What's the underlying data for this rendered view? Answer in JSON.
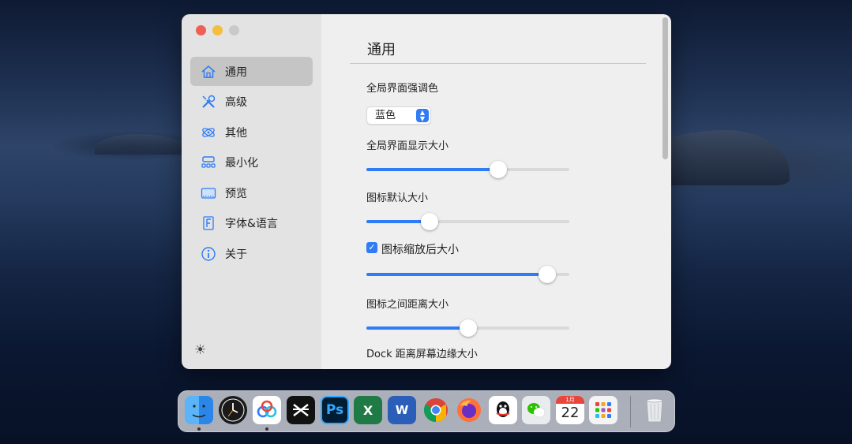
{
  "window": {
    "sidebar": {
      "items": [
        {
          "label": "通用",
          "icon": "home-icon",
          "active": true
        },
        {
          "label": "高级",
          "icon": "tools-icon",
          "active": false
        },
        {
          "label": "其他",
          "icon": "atom-icon",
          "active": false
        },
        {
          "label": "最小化",
          "icon": "minimize-grid-icon",
          "active": false
        },
        {
          "label": "预览",
          "icon": "preview-icon",
          "active": false
        },
        {
          "label": "字体&语言",
          "icon": "font-icon",
          "active": false
        },
        {
          "label": "关于",
          "icon": "info-icon",
          "active": false
        }
      ],
      "theme_toggle_icon": "sun-icon"
    },
    "content": {
      "title": "通用",
      "accent_label": "全局界面强调色",
      "accent_select_value": "蓝色",
      "ui_size_label": "全局界面显示大小",
      "ui_size_value": 0.65,
      "icon_size_label": "图标默认大小",
      "icon_size_value": 0.31,
      "zoom_checkbox_label": "图标缩放后大小",
      "zoom_checked": true,
      "zoom_size_value": 0.89,
      "spacing_label": "图标之间距离大小",
      "spacing_value": 0.5,
      "dock_margin_label": "Dock 距离屏幕边缘大小"
    }
  },
  "dock": {
    "apps": [
      {
        "name": "Finder",
        "icon": "finder-icon",
        "running": true
      },
      {
        "name": "Clock",
        "icon": "clock-icon",
        "running": false
      },
      {
        "name": "Baidu Netdisk",
        "icon": "baidu-netdisk-icon",
        "running": true
      },
      {
        "name": "CapCut",
        "icon": "capcut-icon",
        "running": false
      },
      {
        "name": "Photoshop",
        "icon": "photoshop-icon",
        "label": "Ps",
        "running": false
      },
      {
        "name": "Excel",
        "icon": "excel-icon",
        "label": "X",
        "running": false
      },
      {
        "name": "Word",
        "icon": "word-icon",
        "label": "W",
        "running": false
      },
      {
        "name": "Chrome",
        "icon": "chrome-icon",
        "running": false
      },
      {
        "name": "Firefox",
        "icon": "firefox-icon",
        "running": false
      },
      {
        "name": "QQ",
        "icon": "qq-icon",
        "running": false
      },
      {
        "name": "WeChat",
        "icon": "wechat-icon",
        "running": false
      },
      {
        "name": "Calendar",
        "icon": "calendar-icon",
        "month": "1月",
        "day": "22",
        "running": false
      },
      {
        "name": "Launchpad",
        "icon": "launchpad-icon",
        "running": false
      },
      {
        "name": "Trash",
        "icon": "trash-icon",
        "running": false
      }
    ]
  },
  "colors": {
    "accent": "#2f7cf6",
    "sidebar_bg": "#e3e3e3",
    "content_bg": "#efefef",
    "selected_bg": "#c5c5c5"
  }
}
